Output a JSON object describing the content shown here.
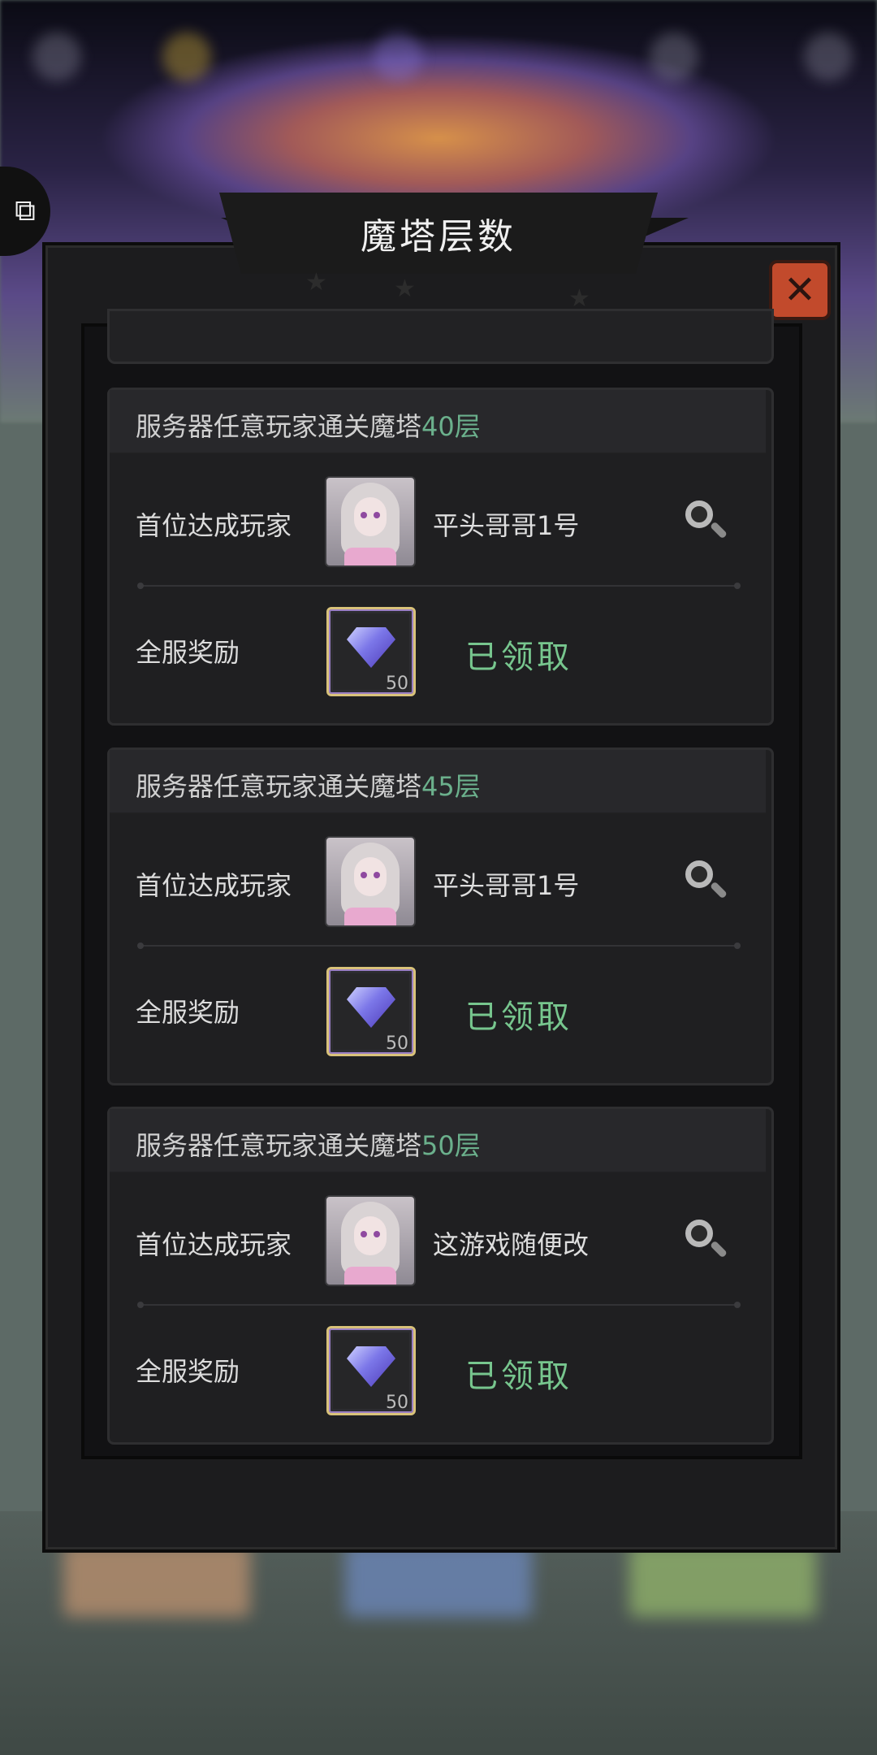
{
  "panel": {
    "title": "魔塔层数",
    "close_icon": "close-icon"
  },
  "cards": [
    {
      "title_prefix": "服务器任意玩家通关魔塔",
      "title_floor": "40层",
      "first_label": "首位达成玩家",
      "player_name": "平头哥哥1号",
      "reward_label": "全服奖励",
      "reward_count": "50",
      "status": "已领取"
    },
    {
      "title_prefix": "服务器任意玩家通关魔塔",
      "title_floor": "45层",
      "first_label": "首位达成玩家",
      "player_name": "平头哥哥1号",
      "reward_label": "全服奖励",
      "reward_count": "50",
      "status": "已领取"
    },
    {
      "title_prefix": "服务器任意玩家通关魔塔",
      "title_floor": "50层",
      "first_label": "首位达成玩家",
      "player_name": "这游戏随便改",
      "reward_label": "全服奖励",
      "reward_count": "50",
      "status": "已领取"
    }
  ],
  "colors": {
    "highlight_green": "#6bb08c",
    "claimed_green": "#77c68e",
    "close_red": "#c24a2c"
  }
}
